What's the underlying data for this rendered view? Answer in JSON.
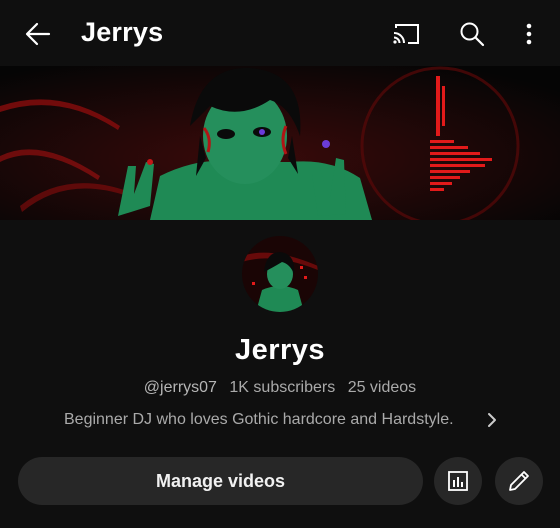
{
  "header": {
    "title": "Jerrys",
    "icons": {
      "back": "arrow-back-icon",
      "cast": "cast-icon",
      "search": "search-icon",
      "more": "more-vertical-icon"
    }
  },
  "channel": {
    "name": "Jerrys",
    "handle": "@jerrys07",
    "subscribers": "1K subscribers",
    "videos": "25 videos",
    "description": "Beginner DJ who loves Gothic hardcore and Hardstyle."
  },
  "actions": {
    "manage_label": "Manage videos",
    "analytics_icon": "analytics-icon",
    "edit_icon": "edit-pencil-icon"
  },
  "colors": {
    "background": "#0f0f0f",
    "button_bg": "#272727",
    "text_primary": "#f1f1f1",
    "text_secondary": "#aaaaaa",
    "banner_accent": "#e21a1a"
  }
}
